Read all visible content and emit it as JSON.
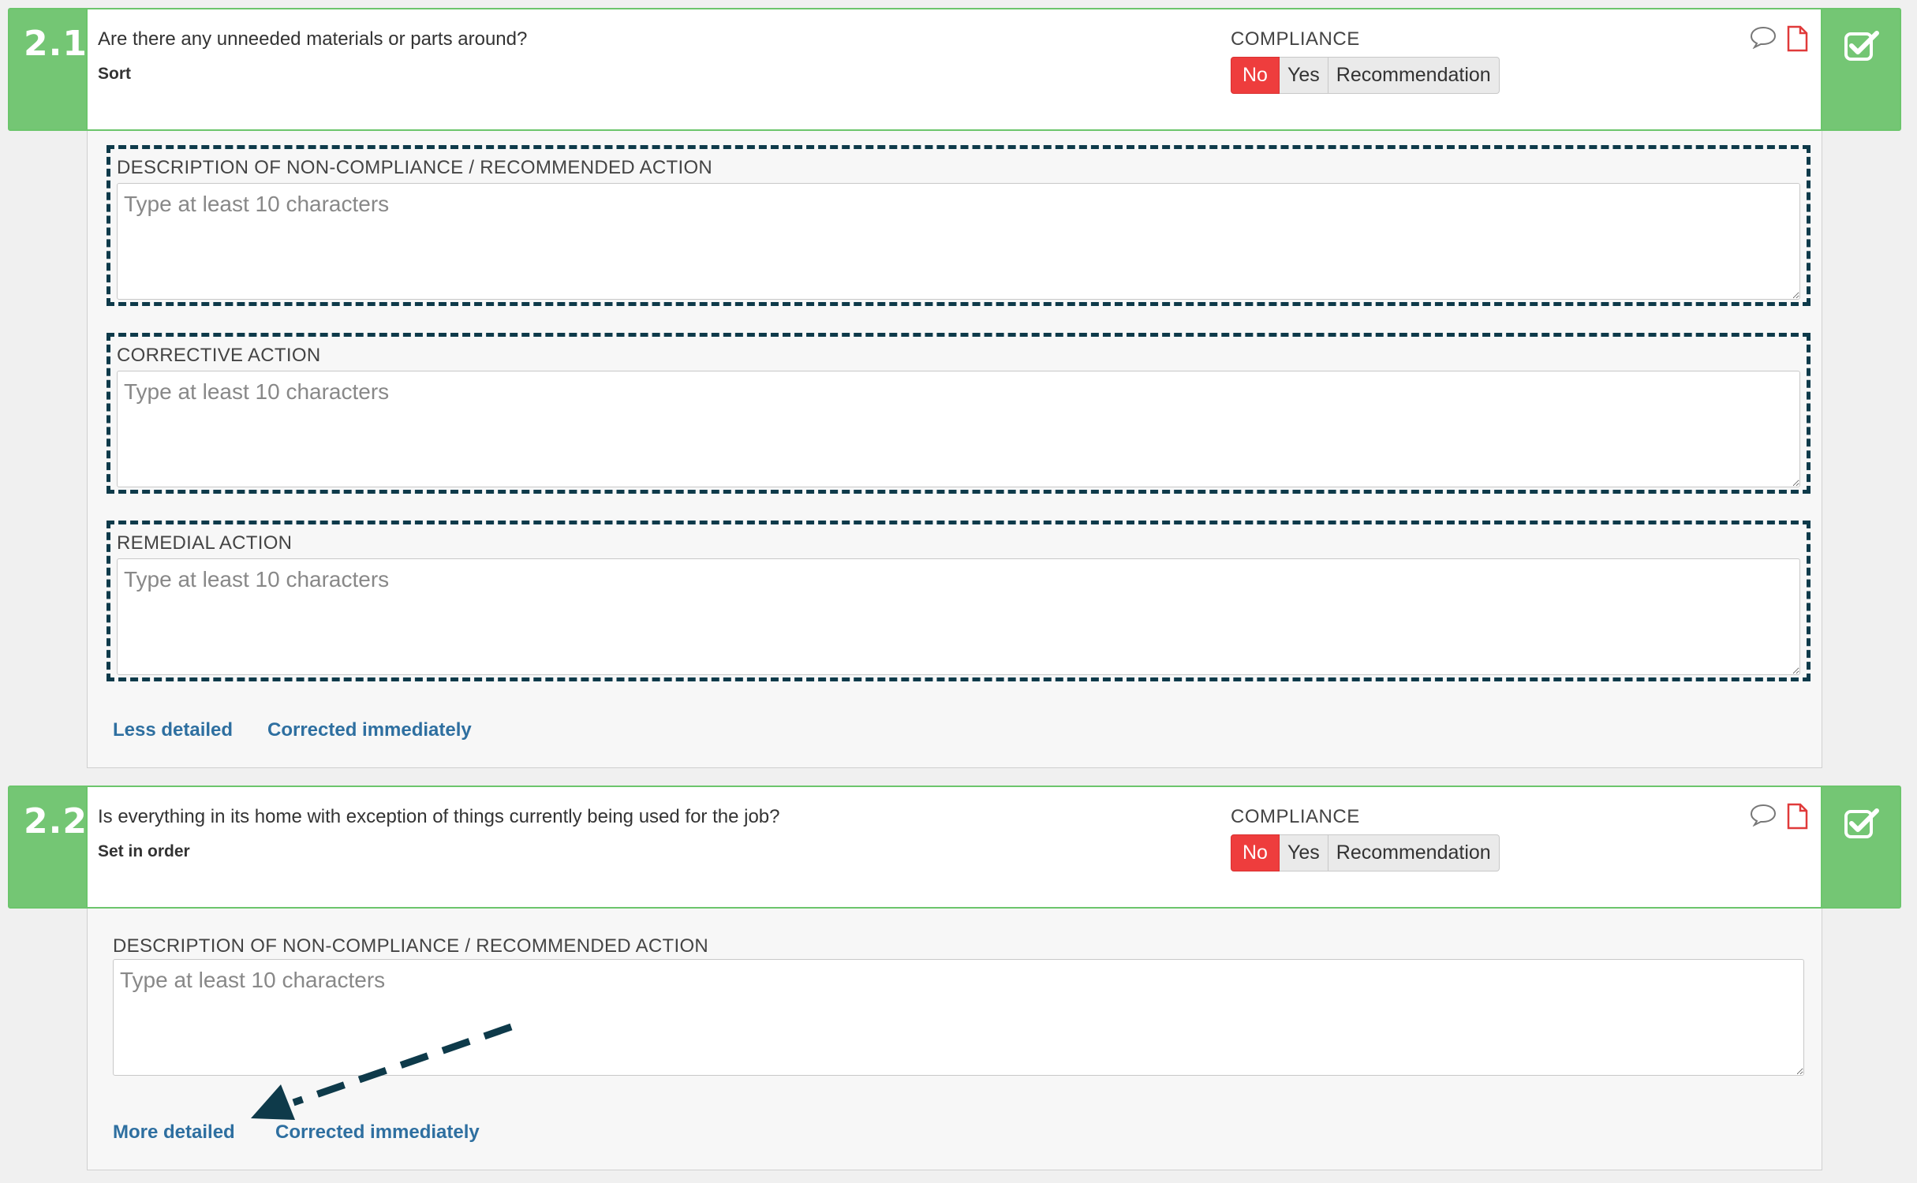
{
  "questions": [
    {
      "number": "2.1",
      "text": "Are there any unneeded materials or parts around?",
      "category": "Sort",
      "compliance_label": "COMPLIANCE",
      "options": {
        "no": "No",
        "yes": "Yes",
        "recommendation": "Recommendation"
      },
      "selected": "No",
      "fields": [
        {
          "label": "DESCRIPTION OF NON-COMPLIANCE / RECOMMENDED ACTION",
          "placeholder": "Type at least 10 characters",
          "value": ""
        },
        {
          "label": "CORRECTIVE ACTION",
          "placeholder": "Type at least 10 characters",
          "value": ""
        },
        {
          "label": "REMEDIAL ACTION",
          "placeholder": "Type at least 10 characters",
          "value": ""
        }
      ],
      "links": {
        "detail_toggle": "Less detailed",
        "corrected": "Corrected immediately"
      }
    },
    {
      "number": "2.2",
      "text": "Is everything in its home with exception of things currently being used for the job?",
      "category": "Set in order",
      "compliance_label": "COMPLIANCE",
      "options": {
        "no": "No",
        "yes": "Yes",
        "recommendation": "Recommendation"
      },
      "selected": "No",
      "fields": [
        {
          "label": "DESCRIPTION OF NON-COMPLIANCE / RECOMMENDED ACTION",
          "placeholder": "Type at least 10 characters",
          "value": ""
        }
      ],
      "links": {
        "detail_toggle": "More detailed",
        "corrected": "Corrected immediately"
      }
    }
  ],
  "icons": {
    "comment": "comment-icon",
    "pdf": "document-icon",
    "check": "checkbox-checked-icon"
  },
  "colors": {
    "accent_green": "#74c674",
    "no_red": "#ee3d3d",
    "link_blue": "#2e6fa0",
    "annotation": "#0e3a4a"
  }
}
